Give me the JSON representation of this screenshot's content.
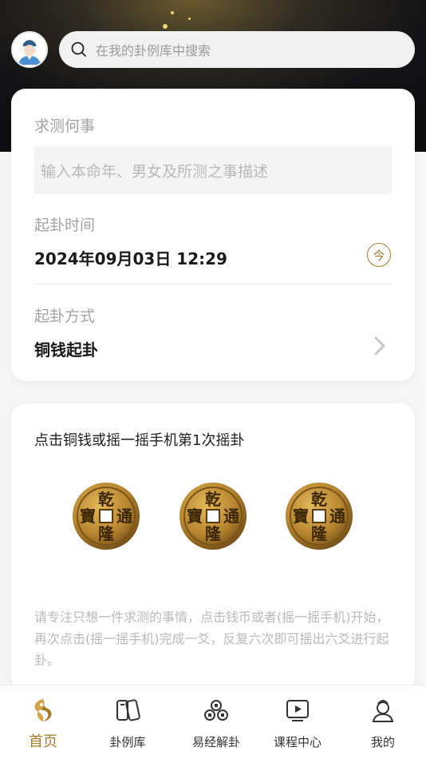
{
  "search": {
    "placeholder": "在我的卦例库中搜索",
    "icon": "search-icon"
  },
  "form": {
    "question_label": "求测何事",
    "question_placeholder": "输入本命年、男女及所测之事描述",
    "time_label": "起卦时间",
    "time_value": "2024年09月03日 12:29",
    "now_button": "今",
    "method_label": "起卦方式",
    "method_value": "铜钱起卦"
  },
  "shake": {
    "prompt": "点击铜钱或摇一摇手机第1次摇卦",
    "coin_chars": [
      "乾",
      "隆",
      "通",
      "寶"
    ],
    "hint": "请专注只想一件求测的事情，点击钱币或者(摇一摇手机)开始，再次点击(摇一摇手机)完成一爻，反复六次即可摇出六爻进行起卦。"
  },
  "tabs": [
    {
      "label": "首页",
      "icon": "home-taiji-icon",
      "active": true
    },
    {
      "label": "卦例库",
      "icon": "case-library-icon",
      "active": false
    },
    {
      "label": "易经解卦",
      "icon": "coins-icon",
      "active": false
    },
    {
      "label": "课程中心",
      "icon": "video-play-icon",
      "active": false
    },
    {
      "label": "我的",
      "icon": "profile-icon",
      "active": false
    }
  ],
  "colors": {
    "accent": "#a67a2a",
    "coin": "#b8862f",
    "header_dark": "#141416"
  }
}
